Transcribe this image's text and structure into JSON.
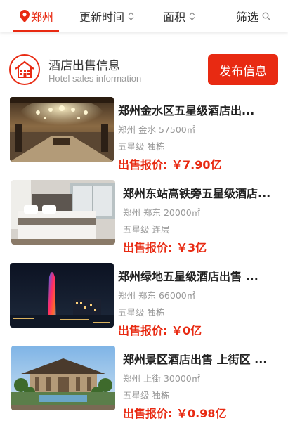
{
  "filters": {
    "city": "郑州",
    "time": "更新时间",
    "area": "面积",
    "filter": "筛选"
  },
  "section": {
    "title": "酒店出售信息",
    "subtitle": "Hotel sales information",
    "publish_label": "发布信息"
  },
  "colors": {
    "accent": "#e82a12"
  },
  "listings": [
    {
      "title": "郑州金水区五星级酒店出...",
      "location": "郑州 金水",
      "area": "57500㎡",
      "tags": "五星级 独栋",
      "price_label": "出售报价:",
      "price": "￥7.90亿"
    },
    {
      "title": "郑州东站高铁旁五星级酒店...",
      "location": "郑州 郑东",
      "area": "20000㎡",
      "tags": "五星级 连层",
      "price_label": "出售报价:",
      "price": "￥3亿"
    },
    {
      "title": "郑州绿地五星级酒店出售 ...",
      "location": "郑州 郑东",
      "area": "66000㎡",
      "tags": "五星级 独栋",
      "price_label": "出售报价:",
      "price": "￥0亿"
    },
    {
      "title": "郑州景区酒店出售 上街区 ...",
      "location": "郑州 上街",
      "area": "30000㎡",
      "tags": "五星级 独栋",
      "price_label": "出售报价:",
      "price": "￥0.98亿"
    }
  ]
}
